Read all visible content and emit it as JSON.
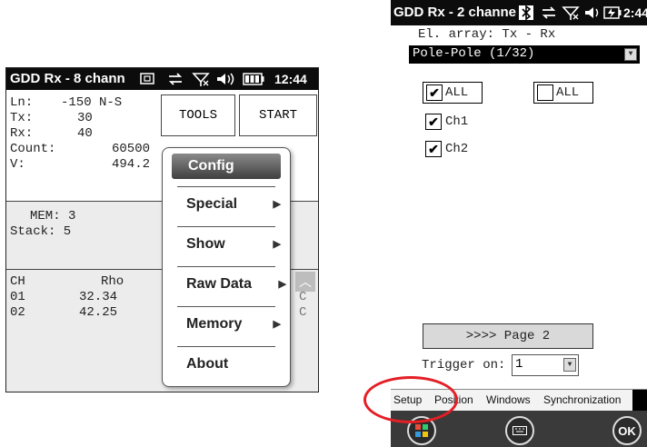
{
  "left": {
    "titlebar": {
      "title": "GDD Rx - 8 chann",
      "time": "12:44"
    },
    "fields": [
      {
        "label": "Ln:",
        "value": "-150 N-S"
      },
      {
        "label": "Tx:",
        "value": "30"
      },
      {
        "label": "Rx:",
        "value": "40"
      },
      {
        "label": "Count:",
        "value": "60500"
      },
      {
        "label": "V:",
        "value": "494.2"
      }
    ],
    "buttons": {
      "tools": "TOOLS",
      "start": "START"
    },
    "mem": {
      "mem_label": "MEM: 3",
      "stack_label": "Stack: 5"
    },
    "table": {
      "headers": [
        "CH",
        "Rho"
      ],
      "rows": [
        {
          "ch": "01",
          "rho": "32.34",
          "tail": "C"
        },
        {
          "ch": "02",
          "rho": "42.25",
          "tail": "C"
        }
      ]
    },
    "menu": {
      "items": [
        {
          "label": "Config",
          "selected": true,
          "submenu": false
        },
        {
          "label": "Special",
          "submenu": true
        },
        {
          "label": "Show",
          "submenu": true
        },
        {
          "label": "Raw Data",
          "submenu": true
        },
        {
          "label": "Memory",
          "submenu": true
        },
        {
          "label": "About",
          "submenu": false
        }
      ]
    }
  },
  "right": {
    "titlebar": {
      "title": "GDD Rx - 2 channe",
      "time": "2:44"
    },
    "array_label": "El. array: Tx - Rx",
    "array_select": "Pole-Pole (1/32)",
    "checkboxes": {
      "all_checked": {
        "label": "ALL",
        "checked": true
      },
      "all_unchecked": {
        "label": "ALL",
        "checked": false
      },
      "ch1": {
        "label": "Ch1",
        "checked": true
      },
      "ch2": {
        "label": "Ch2",
        "checked": true
      }
    },
    "page_button": ">>>> Page 2",
    "trigger": {
      "label": "Trigger on:",
      "value": "1"
    },
    "tabs": [
      "Setup",
      "Position",
      "Windows",
      "Synchronization"
    ],
    "bottom": {
      "ok": "OK"
    }
  },
  "colors": {
    "annotation": "#e41f26",
    "titlebar": "#0c0c0c"
  }
}
